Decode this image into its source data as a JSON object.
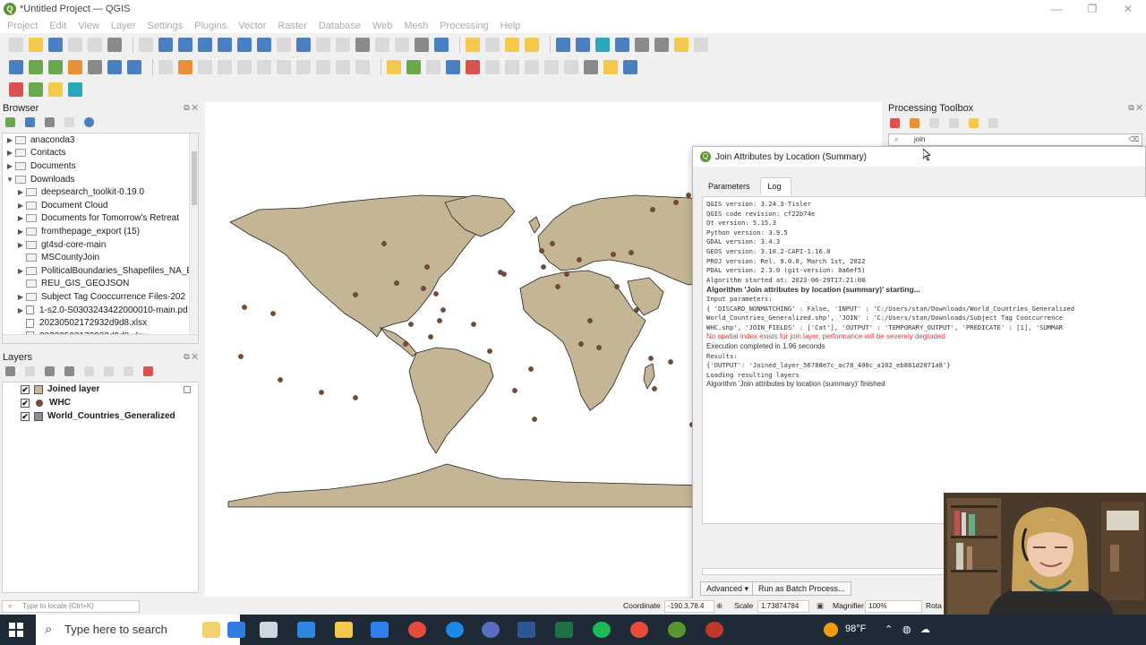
{
  "window": {
    "title": "*Untitled Project — QGIS"
  },
  "menu": [
    "Project",
    "Edit",
    "View",
    "Layer",
    "Settings",
    "Plugins",
    "Vector",
    "Raster",
    "Database",
    "Web",
    "Mesh",
    "Processing",
    "Help"
  ],
  "browser": {
    "title": "Browser",
    "items": [
      {
        "label": "anaconda3",
        "indent": 1,
        "kind": "folder",
        "arrow": "▶"
      },
      {
        "label": "Contacts",
        "indent": 1,
        "kind": "folder",
        "arrow": "▶"
      },
      {
        "label": "Documents",
        "indent": 1,
        "kind": "folder",
        "arrow": "▶"
      },
      {
        "label": "Downloads",
        "indent": 1,
        "kind": "folder",
        "arrow": "▼"
      },
      {
        "label": "deepsearch_toolkit-0.19.0",
        "indent": 2,
        "kind": "folder",
        "arrow": "▶"
      },
      {
        "label": "Document Cloud",
        "indent": 2,
        "kind": "folder",
        "arrow": "▶"
      },
      {
        "label": "Documents for Tomorrow's Retreat",
        "indent": 2,
        "kind": "folder",
        "arrow": "▶"
      },
      {
        "label": "fromthepage_export (15)",
        "indent": 2,
        "kind": "folder",
        "arrow": "▶"
      },
      {
        "label": "gt4sd-core-main",
        "indent": 2,
        "kind": "folder",
        "arrow": "▶"
      },
      {
        "label": "MSCountyJoin",
        "indent": 2,
        "kind": "folder",
        "arrow": ""
      },
      {
        "label": "PoliticalBoundaries_Shapefiles_NA_E",
        "indent": 2,
        "kind": "folder",
        "arrow": "▶"
      },
      {
        "label": "REU_GIS_GEOJSON",
        "indent": 2,
        "kind": "folder",
        "arrow": ""
      },
      {
        "label": "Subject Tag Cooccurrence Files-202",
        "indent": 2,
        "kind": "folder",
        "arrow": "▶"
      },
      {
        "label": "1-s2.0-S0303243422000010-main.pd",
        "indent": 2,
        "kind": "file",
        "arrow": "▶"
      },
      {
        "label": "20230502172932d9d8.xlsx",
        "indent": 2,
        "kind": "file",
        "arrow": ""
      },
      {
        "label": "20230502172932d9d8.xlsx",
        "indent": 2,
        "kind": "file",
        "arrow": ""
      }
    ]
  },
  "layers": {
    "title": "Layers",
    "items": [
      {
        "label": "Joined layer",
        "symbol": "square-tan",
        "checked": "✔"
      },
      {
        "label": "WHC",
        "symbol": "dot-brown",
        "checked": "✔"
      },
      {
        "label": "World_Countries_Generalized",
        "symbol": "square-gray",
        "checked": "✔"
      }
    ]
  },
  "processing": {
    "title": "Processing Toolbox",
    "search_value": "join"
  },
  "dialog": {
    "title": "Join Attributes by Location (Summary)",
    "tabs": [
      "Parameters",
      "Log"
    ],
    "active_tab": "Log",
    "log": [
      {
        "text": "QGIS version: 3.24.3-Tisler",
        "style": "mono"
      },
      {
        "text": "QGIS code revision: cf22b74e",
        "style": "mono"
      },
      {
        "text": "Qt version: 5.15.3",
        "style": "mono"
      },
      {
        "text": "Python version: 3.9.5",
        "style": "mono"
      },
      {
        "text": "GDAL version: 3.4.3",
        "style": "mono"
      },
      {
        "text": "GEOS version: 3.10.2-CAPI-1.16.0",
        "style": "mono"
      },
      {
        "text": "PROJ version: Rel. 9.0.0, March 1st, 2022",
        "style": "mono"
      },
      {
        "text": "PDAL version: 2.3.0 (git-version: 0a6ef5)",
        "style": "mono"
      },
      {
        "text": "Algorithm started at: 2023-06-29T17:21:08",
        "style": "mono"
      },
      {
        "text": "Algorithm 'Join attributes by location (summary)' starting...",
        "style": "bold"
      },
      {
        "text": "Input parameters:",
        "style": "mono"
      },
      {
        "text": "{ 'DISCARD_NONMATCHING' : False, 'INPUT' : 'C:/Users/stan/Downloads/World_Countries_Generalized",
        "style": "mono"
      },
      {
        "text": "World_Countries_Generalized.shp', 'JOIN' : 'C:/Users/stan/Downloads/Subject Tag Cooccurrence",
        "style": "mono"
      },
      {
        "text": "WHC.shp', 'JOIN_FIELDS' : ['Cat'], 'OUTPUT' : 'TEMPORARY_OUTPUT', 'PREDICATE' : [1], 'SUMMAR",
        "style": "mono"
      },
      {
        "text": "",
        "style": "mono"
      },
      {
        "text": "No spatial index exists for join layer, performance will be severely degraded",
        "style": "warn"
      },
      {
        "text": "Execution completed in 1.96 seconds",
        "style": "sans"
      },
      {
        "text": "Results:",
        "style": "mono"
      },
      {
        "text": "{'OUTPUT': 'Joined_layer_56788e7c_ac78_400c_a102_eb881d2071a8'}",
        "style": "mono"
      },
      {
        "text": "",
        "style": "mono"
      },
      {
        "text": "Loading resulting layers",
        "style": "mono"
      },
      {
        "text": "Algorithm 'Join attributes by location (summary)' finished",
        "style": "sans"
      }
    ],
    "advanced_label": "Advanced ▾",
    "batch_label": "Run as Batch Process..."
  },
  "statusbar": {
    "locate_placeholder": "Type to locate (Ctrl+K)",
    "coordinate_label": "Coordinate",
    "coordinate_value": "-190.3,78.4",
    "scale_label": "Scale",
    "scale_value": "1:73874784",
    "magnifier_label": "Magnifier",
    "magnifier_value": "100%",
    "rotation_label": "Rota"
  },
  "taskbar": {
    "search_placeholder": "Type here to search",
    "weather": "98°F"
  },
  "colors": {
    "land": "#c4b695",
    "ocean": "#ffffff",
    "site_dot": "#7a4a35",
    "accent": "#589632"
  }
}
